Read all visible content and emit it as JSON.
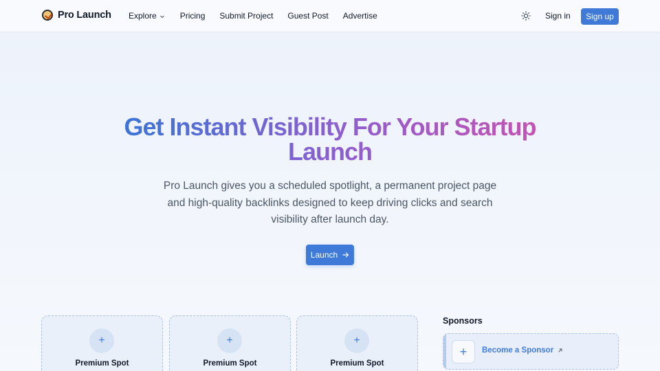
{
  "header": {
    "brand": "Pro Launch",
    "nav": {
      "explore": "Explore",
      "pricing": "Pricing",
      "submit": "Submit Project",
      "guest_post": "Guest Post",
      "advertise": "Advertise"
    },
    "theme_icon": "sun-icon",
    "signin": "Sign in",
    "signup": "Sign up"
  },
  "hero": {
    "title_line1": "Get Instant Visibility For Your Startup",
    "title_line2": "Launch",
    "subtitle": "Pro Launch gives you a scheduled spotlight, a permanent project page and high-quality backlinks designed to keep driving clicks and search visibility after launch day.",
    "cta": "Launch",
    "cta_icon": "arrow-right-icon"
  },
  "spots": [
    {
      "label": "Premium Spot",
      "icon": "plus-icon"
    },
    {
      "label": "Premium Spot",
      "icon": "plus-icon"
    },
    {
      "label": "Premium Spot",
      "icon": "plus-icon"
    }
  ],
  "sponsors": {
    "title": "Sponsors",
    "cta": "Become a Sponsor",
    "cta_icon": "external-link-icon"
  },
  "colors": {
    "accent": "#3f7ad9",
    "gradient_start": "#3f74d6",
    "gradient_mid": "#8a5fd0",
    "gradient_end": "#c254b4"
  }
}
